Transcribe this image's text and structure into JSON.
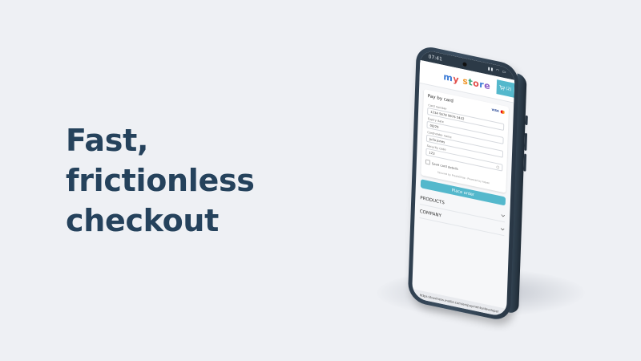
{
  "headline": {
    "lines": [
      "Fast,",
      "frictionless",
      "checkout"
    ]
  },
  "phone": {
    "status": {
      "time": "07:41",
      "signal": "▮▮ ◠ ▭"
    },
    "store": {
      "logo_letters": [
        "m",
        "y",
        " ",
        "s",
        "t",
        "o",
        "r",
        "e"
      ],
      "cart_label": "(2)",
      "cart_icon": "cart-icon"
    },
    "pay": {
      "title": "Pay by card",
      "brands": {
        "visa": "VISA"
      },
      "card_number_label": "Card number",
      "card_number_value": "1234 5678 9876 5432",
      "expiry_label": "Expiry date",
      "expiry_value": "08/29",
      "holder_label": "Cardholder name",
      "holder_value": "Julia Jones",
      "cvc_label": "Security code",
      "cvc_value": "123",
      "save_label": "Save card details",
      "secured_text": "Secured by PrestaShop · Powered by Adyen"
    },
    "place_order": "Place order",
    "accordions": [
      {
        "label": "PRODUCTS"
      },
      {
        "label": "COMPANY"
      }
    ],
    "url": "https://business.mollie.com/en/payments/developer"
  },
  "colors": {
    "accent": "#54b8cc",
    "headline": "#25425c",
    "background": "#eef0f4"
  }
}
